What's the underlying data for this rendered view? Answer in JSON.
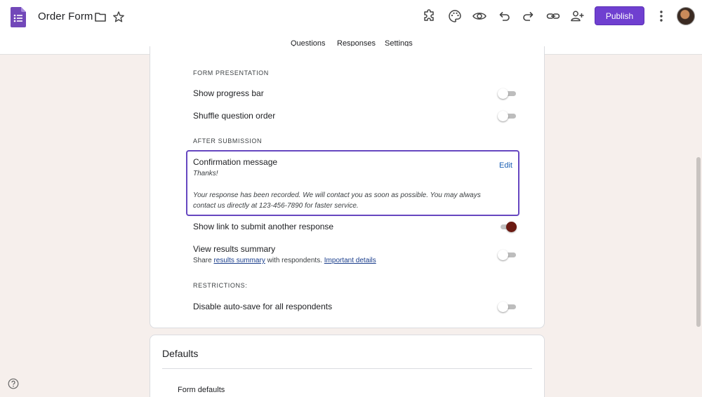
{
  "header": {
    "form_title": "Order Form",
    "publish_label": "Publish",
    "toolbar_icons": [
      "add-ons-icon",
      "palette-icon",
      "preview-eye-icon",
      "undo-icon",
      "redo-icon",
      "link-icon",
      "add-collaborator-icon"
    ]
  },
  "tabs": [
    {
      "label": "Questions"
    },
    {
      "label": "Responses"
    },
    {
      "label": "Settings",
      "active": true
    }
  ],
  "presentation": {
    "heading": "FORM PRESENTATION",
    "show_progress_bar": {
      "label": "Show progress bar",
      "enabled": false
    },
    "shuffle_question_order": {
      "label": "Shuffle question order",
      "enabled": false
    }
  },
  "after_submission": {
    "heading": "AFTER SUBMISSION",
    "confirmation": {
      "title": "Confirmation message",
      "edit_label": "Edit",
      "thanks": "Thanks!",
      "message": "Your response has been recorded. We will contact you as soon as possible. You may always contact us directly at 123-456-7890 for faster service."
    },
    "show_link": {
      "label": "Show link to submit another response",
      "enabled": true
    },
    "view_results": {
      "label": "View results summary",
      "enabled": false,
      "share_prefix": "Share",
      "share_link": "results summary",
      "share_middle": "with respondents.",
      "details_link": "Important details"
    }
  },
  "restrictions": {
    "heading": "RESTRICTIONS:",
    "disable_autosave": {
      "label": "Disable auto-save for all respondents",
      "enabled": false
    }
  },
  "defaults": {
    "title": "Defaults",
    "form_defaults": "Form defaults"
  },
  "colors": {
    "accent": "#6b1a12",
    "publish": "#6f3fd0",
    "focus_border": "#6647c0",
    "link": "#1a5fb4",
    "background": "#f6efec"
  }
}
